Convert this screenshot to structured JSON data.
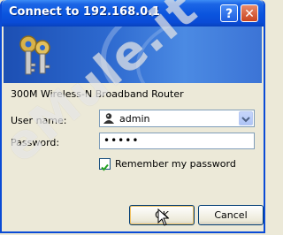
{
  "window": {
    "title": "Connect to 192.168.0.1",
    "help_glyph": "?",
    "close_glyph": "✕"
  },
  "dialog": {
    "router_label": "300M Wireless-N Broadband Router",
    "username_label": "User name:",
    "username_value": "admin",
    "password_label": "Password:",
    "password_value": "•••••",
    "remember_label": "Remember my password",
    "remember_checked": true,
    "ok_label": "OK",
    "cancel_label": "Cancel"
  },
  "watermark": "eMule.it",
  "colors": {
    "titlebar": "#0a4bd6",
    "banner": "#2d69cf",
    "dialog_bg": "#ece9d8"
  }
}
